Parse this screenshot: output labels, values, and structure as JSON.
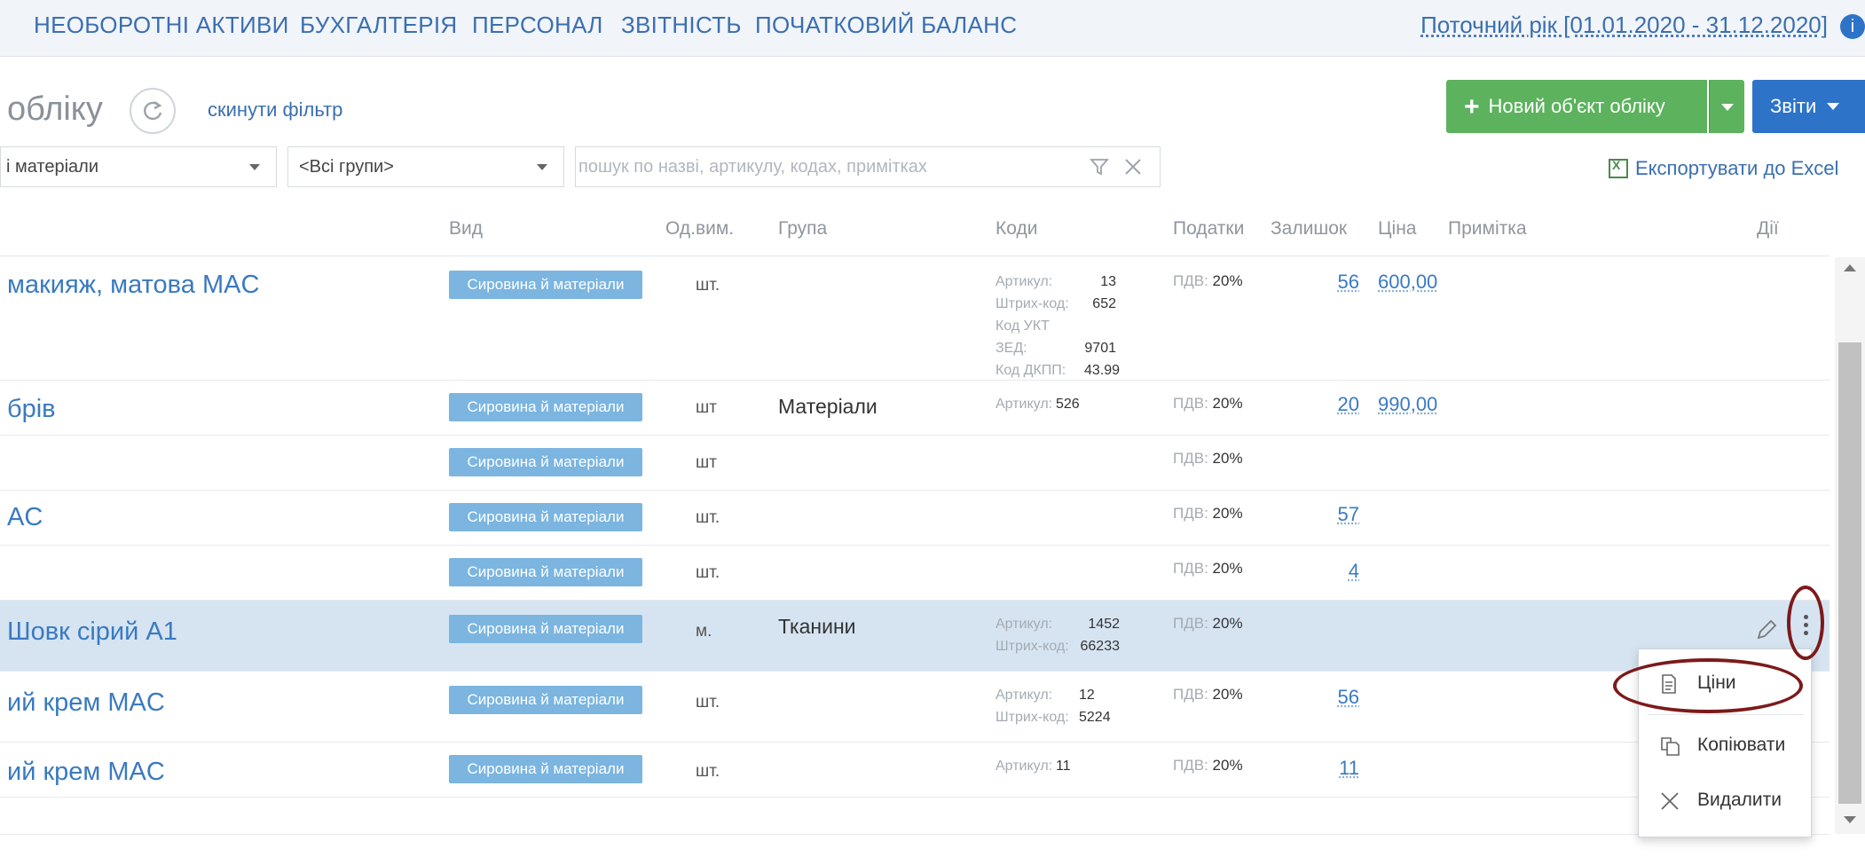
{
  "topnav": {
    "items": [
      "НЕОБОРОТНІ АКТИВИ",
      "БУХГАЛТЕРІЯ",
      "ПЕРСОНАЛ",
      "ЗВІТНІСТЬ",
      "ПОЧАТКОВИЙ БАЛАНС"
    ],
    "period": "Поточний рік [01.01.2020 - 31.12.2020]"
  },
  "toolbar": {
    "title": "обліку",
    "reset_filter": "скинути фільтр",
    "new_object": "Новий об'єкт обліку",
    "reports": "Звіти",
    "export": "Експортувати до Excel"
  },
  "filters": {
    "type_value": "і матеріали",
    "group_value": "<Всі групи>",
    "search_placeholder": "пошук по назві, артикулу, кодах, примітках"
  },
  "table": {
    "columns": {
      "kind": "Вид",
      "unit": "Од.вим.",
      "group": "Група",
      "codes": "Коди",
      "taxes": "Податки",
      "stock": "Залишок",
      "price": "Ціна",
      "note": "Примітка",
      "actions": "Дії"
    },
    "rows": [
      {
        "name": "макияж, матова MAC",
        "kind": "Сировина й матеріали",
        "unit": "шт.",
        "group": "",
        "codes": [
          {
            "label": "Артикул:",
            "value": "13"
          },
          {
            "label": "Штрих-код:",
            "value": "652"
          },
          {
            "label": "Код УКТ ЗЕД:",
            "value": "9701"
          },
          {
            "label": "Код ДКПП:",
            "value": "43.99"
          }
        ],
        "vat_label": "ПДВ:",
        "vat_value": "20%",
        "stock": "56",
        "price": "600,00"
      },
      {
        "name": "брів",
        "kind": "Сировина й матеріали",
        "unit": "шт",
        "group": "Матеріали",
        "codes": [
          {
            "label": "Артикул:",
            "value": "526"
          }
        ],
        "vat_label": "ПДВ:",
        "vat_value": "20%",
        "stock": "20",
        "price": "990,00"
      },
      {
        "name": "",
        "kind": "Сировина й матеріали",
        "unit": "шт",
        "group": "",
        "codes": [],
        "vat_label": "ПДВ:",
        "vat_value": "20%",
        "stock": "",
        "price": ""
      },
      {
        "name": "AC",
        "kind": "Сировина й матеріали",
        "unit": "шт.",
        "group": "",
        "codes": [],
        "vat_label": "ПДВ:",
        "vat_value": "20%",
        "stock": "57",
        "price": ""
      },
      {
        "name": "",
        "kind": "Сировина й матеріали",
        "unit": "шт.",
        "group": "",
        "codes": [],
        "vat_label": "ПДВ:",
        "vat_value": "20%",
        "stock": "4",
        "price": ""
      },
      {
        "name": "Шовк сірий А1",
        "kind": "Сировина й матеріали",
        "unit": "м.",
        "group": "Тканини",
        "codes": [
          {
            "label": "Артикул:",
            "value": "1452"
          },
          {
            "label": "Штрих-код:",
            "value": "66233"
          }
        ],
        "vat_label": "ПДВ:",
        "vat_value": "20%",
        "stock": "",
        "price": ""
      },
      {
        "name": "ий крем MAC",
        "kind": "Сировина й матеріали",
        "unit": "шт.",
        "group": "",
        "codes": [
          {
            "label": "Артикул:",
            "value": "12"
          },
          {
            "label": "Штрих-код:",
            "value": "5224"
          }
        ],
        "vat_label": "ПДВ:",
        "vat_value": "20%",
        "stock": "56",
        "price": ""
      },
      {
        "name": "ий крем MAC",
        "kind": "Сировина й матеріали",
        "unit": "шт.",
        "group": "",
        "codes": [
          {
            "label": "Артикул:",
            "value": "11"
          }
        ],
        "vat_label": "ПДВ:",
        "vat_value": "20%",
        "stock": "11",
        "price": ""
      }
    ]
  },
  "context_menu": {
    "items": [
      {
        "label": "Ціни",
        "icon": "document-icon"
      },
      {
        "label": "Копіювати",
        "icon": "copy-icon"
      },
      {
        "label": "Видалити",
        "icon": "close-icon"
      }
    ]
  },
  "colors": {
    "link": "#3a7ac0",
    "nav_bg": "#f1f4f9",
    "primary_green": "#5cb25d",
    "primary_blue": "#2d73c8",
    "badge": "#7bb5e0",
    "selected_row": "#d6e4f2",
    "annotation": "#7c1a1a"
  }
}
